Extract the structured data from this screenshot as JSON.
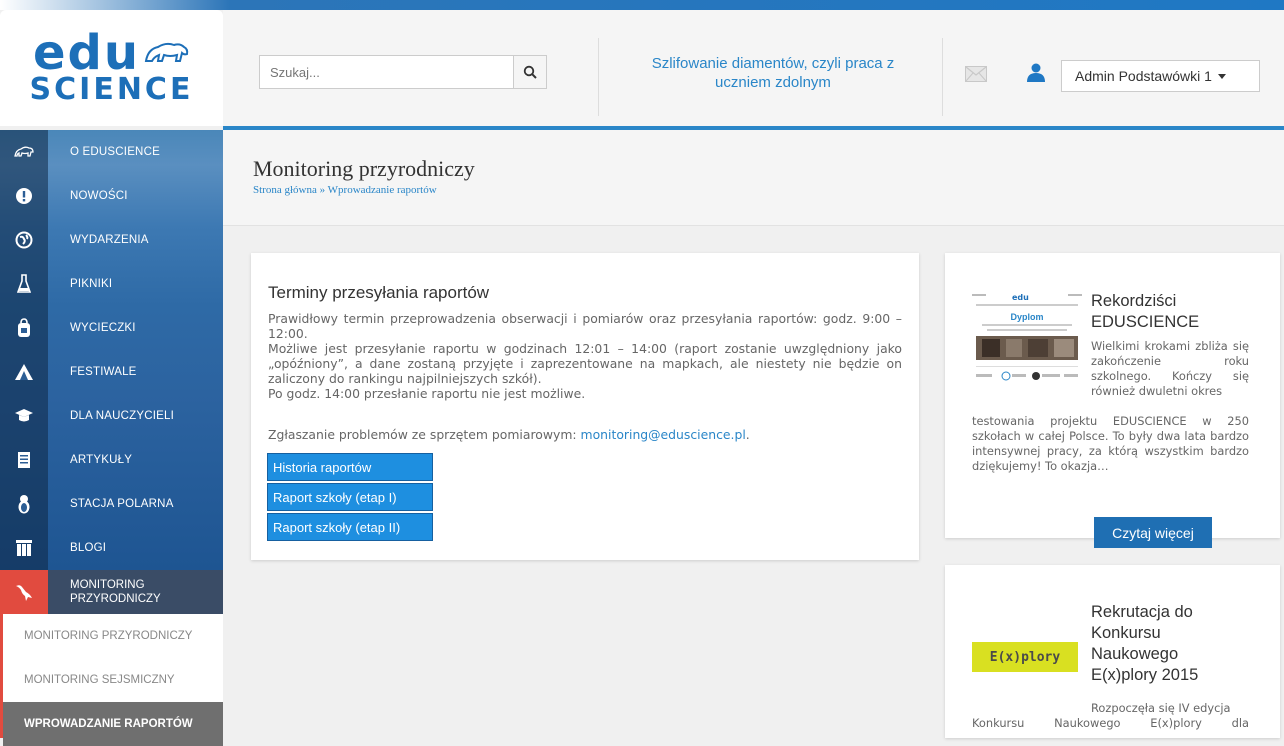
{
  "header": {
    "search_placeholder": "Szukaj...",
    "tagline": "Szlifowanie diamentów, czyli praca z uczniem zdolnym",
    "user_name": "Admin Podstawówki 1",
    "logo_top": "edu",
    "logo_bottom": "SCIENCE"
  },
  "sidebar": {
    "items": [
      {
        "label": "O EDUSCIENCE",
        "icon": "polar-bear-icon"
      },
      {
        "label": "NOWOŚCI",
        "icon": "exclamation-icon"
      },
      {
        "label": "WYDARZENIA",
        "icon": "globe-icon"
      },
      {
        "label": "PIKNIKI",
        "icon": "flask-icon"
      },
      {
        "label": "WYCIECZKI",
        "icon": "backpack-icon"
      },
      {
        "label": "FESTIWALE",
        "icon": "tent-icon"
      },
      {
        "label": "DLA NAUCZYCIELI",
        "icon": "graduation-cap-icon"
      },
      {
        "label": "ARTYKUŁY",
        "icon": "document-icon"
      },
      {
        "label": "STACJA POLARNA",
        "icon": "penguin-icon"
      },
      {
        "label": "BLOGI",
        "icon": "people-icon"
      }
    ],
    "active": {
      "label_line1": "MONITORING",
      "label_line2": "PRZYRODNICZY",
      "icon": "bird-icon"
    },
    "sub_items": [
      "MONITORING PRZYRODNICZY",
      "MONITORING SEJSMICZNY",
      "WPROWADZANIE RAPORTÓW"
    ]
  },
  "page": {
    "title": "Monitoring przyrodniczy",
    "breadcrumb": "Strona główna » Wprowadzanie raportów"
  },
  "main_card": {
    "title": "Terminy przesyłania raportów",
    "p1": "Prawidłowy termin przeprowadzenia obserwacji i pomiarów oraz przesyłania raportów: godz. 9:00 – 12:00.",
    "p2": "Możliwe jest przesyłanie raportu w godzinach 12:01 – 14:00 (raport zostanie uwzględniony jako „opóźniony”, a dane zostaną przyjęte i zaprezentowane na mapkach, ale niestety nie będzie on zaliczony do rankingu najpilniejszych szkół).",
    "p3": "Po godz. 14:00 przesłanie raportu nie jest możliwe.",
    "contact_text": "Zgłaszanie problemów ze sprzętem pomiarowym: ",
    "contact_email": "monitoring@eduscience.pl",
    "contact_end": ".",
    "buttons": [
      "Historia raportów",
      "Raport szkoły (etap I)",
      "Raport szkoły (etap II)"
    ]
  },
  "news": [
    {
      "title": "Rekordziści EDUSCIENCE",
      "text_side": "Wielkimi krokami zbliża się zakończenie roku szkolnego. Kończy się również dwuletni okres",
      "text_full": "testowania projektu EDUSCIENCE w 250 szkołach w całej Polsce. To były dwa lata bardzo intensywnej pracy, za którą wszystkim bardzo dziękujemy! To okazja…",
      "button": "Czytaj więcej",
      "thumb_label": "Dyplom"
    },
    {
      "title": "Rekrutacja do Konkursu Naukowego E(x)plory 2015",
      "text_side": "Rozpoczęła się IV edycja",
      "text_full": "Konkursu Naukowego E(x)plory dla",
      "thumb_label": "E(x)plory"
    }
  ],
  "colors": {
    "accent": "#2a86c8",
    "active_red": "#e14b3f",
    "button_blue": "#1e8fe0"
  }
}
